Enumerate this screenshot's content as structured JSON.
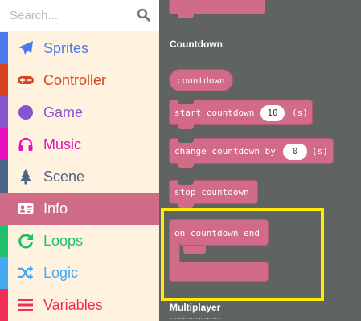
{
  "search": {
    "placeholder": "Search..."
  },
  "categories": [
    {
      "label": "Sprites",
      "icon": "paper-plane-icon",
      "color": "#4b7bec"
    },
    {
      "label": "Controller",
      "icon": "gamepad-icon",
      "color": "#d54322"
    },
    {
      "label": "Game",
      "icon": "circle-icon",
      "color": "#8854d0"
    },
    {
      "label": "Music",
      "icon": "headphones-icon",
      "color": "#e30fc0"
    },
    {
      "label": "Scene",
      "icon": "tree-icon",
      "color": "#4b6584"
    },
    {
      "label": "Info",
      "icon": "id-card-icon",
      "color": "#cf6a87",
      "selected": true
    },
    {
      "label": "Loops",
      "icon": "refresh-icon",
      "color": "#20bf6b"
    },
    {
      "label": "Logic",
      "icon": "shuffle-icon",
      "color": "#45aaf2"
    },
    {
      "label": "Variables",
      "icon": "list-icon",
      "color": "#ef2d56"
    }
  ],
  "flyout": {
    "section_countdown": "Countdown",
    "section_multiplayer": "Multiplayer",
    "blocks": {
      "countdown": "countdown",
      "start_countdown": "start countdown",
      "start_countdown_value": "10",
      "start_countdown_unit": "(s)",
      "change_countdown": "change countdown by",
      "change_countdown_value": "0",
      "change_countdown_unit": "(s)",
      "stop_countdown": "stop countdown",
      "on_countdown_end": "on countdown end"
    }
  },
  "colors": {
    "info_block": "#d16b87",
    "highlight": "#ffeb00",
    "workspace": "#5f6362",
    "category_background": "#fff3e0"
  }
}
